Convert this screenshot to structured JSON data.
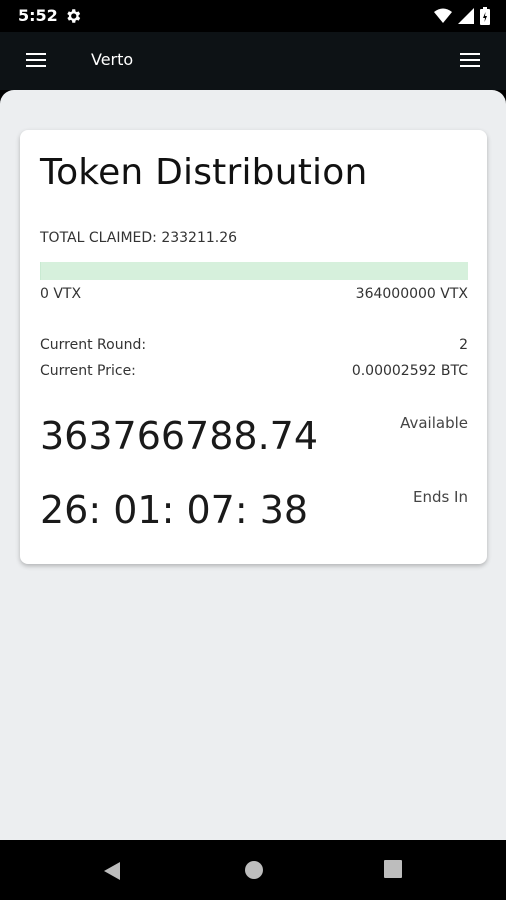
{
  "status_bar": {
    "time": "5:52",
    "icons": [
      "gear-icon",
      "wifi-icon",
      "signal-icon",
      "battery-icon"
    ]
  },
  "app_bar": {
    "title": "Verto",
    "left_icon": "menu-icon",
    "right_icon": "menu-icon"
  },
  "card": {
    "title": "Token Distribution",
    "total_claimed": "TOTAL CLAIMED: 233211.26",
    "progress_fraction": 0.00064,
    "progress_color": "#c9ead2",
    "range_min": "0 VTX",
    "range_max": "364000000 VTX",
    "current_round_label": "Current Round:",
    "current_round_value": "2",
    "current_price_label": "Current Price:",
    "current_price_value": "0.00002592 BTC",
    "available_value": "363766788.74",
    "available_label": "Available",
    "countdown_value": "26: 01: 07: 38",
    "countdown_label": "Ends In"
  },
  "nav_bar": {
    "icons": [
      "back-icon",
      "home-icon",
      "recents-icon"
    ]
  }
}
